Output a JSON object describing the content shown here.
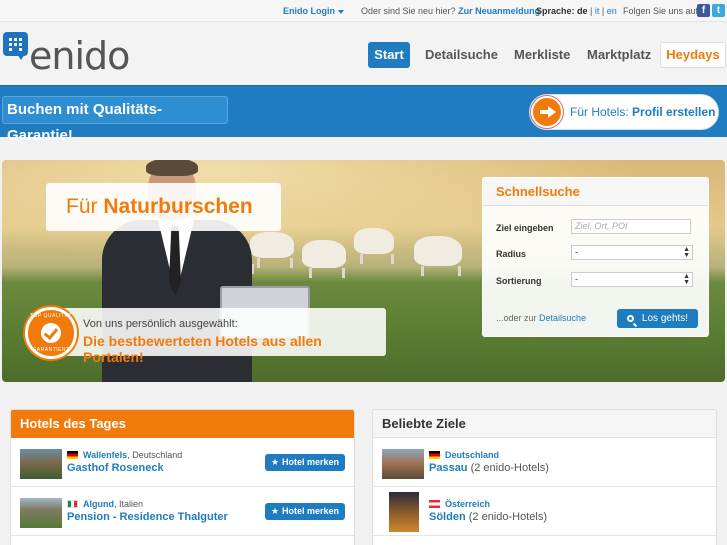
{
  "topbar": {
    "login": "Enido Login",
    "new_text": "Oder sind Sie neu hier?",
    "new_link": "Zur Neuanmeldung",
    "lang_label": "Sprache:",
    "lang_current": "de",
    "lang_it": "it",
    "lang_en": "en",
    "follow": "Folgen Sie uns auf:",
    "facebook": "f",
    "twitter": "t"
  },
  "header": {
    "logo": "enido",
    "nav": [
      "Start",
      "Detailsuche",
      "Merkliste",
      "Marktplatz",
      "Heydays"
    ]
  },
  "band": {
    "guarantee": "Buchen mit Qualitäts-Garantie!",
    "profile_prefix": "Für Hotels:",
    "profile_action": "Profil erstellen"
  },
  "hero": {
    "caption_prefix": "Für",
    "caption_bold": "Naturburschen",
    "strip_small": "Von uns persönlich ausgewählt:",
    "strip_large": "Die bestbewerteten Hotels aus allen Portalen!",
    "seal_top": "TOP QUALITÄT",
    "seal_bottom": "GARANTIERT"
  },
  "quicksearch": {
    "title": "Schnellsuche",
    "target_label": "Ziel eingeben",
    "target_placeholder": "Ziel, Ort, POI",
    "radius_label": "Radius",
    "radius_value": "-",
    "sort_label": "Sortierung",
    "sort_value": "-",
    "or_text": "...oder zur",
    "or_link": "Detailsuche",
    "go": "Los gehts!"
  },
  "hotels_today": {
    "title": "Hotels des Tages",
    "items": [
      {
        "city": "Wallenfels",
        "country": "Deutschland",
        "name": "Gasthof Roseneck",
        "button": "Hotel merken",
        "flag": "de"
      },
      {
        "city": "Algund",
        "country": "Italien",
        "name": "Pension - Residence Thalguter",
        "button": "Hotel merken",
        "flag": "it"
      }
    ]
  },
  "popular": {
    "title": "Beliebte Ziele",
    "items": [
      {
        "country": "Deutschland",
        "city": "Passau",
        "count": "(2 enido-Hotels)",
        "flag": "de"
      },
      {
        "country": "Österreich",
        "city": "Sölden",
        "count": "(2 enido-Hotels)",
        "flag": "at"
      }
    ]
  },
  "colors": {
    "primary": "#1f7cc0",
    "accent": "#f07b0a"
  }
}
